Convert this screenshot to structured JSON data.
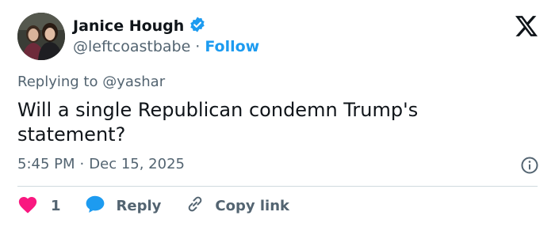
{
  "author": {
    "name": "Janice Hough",
    "handle": "@leftcoastbabe",
    "separator": "·",
    "follow_label": "Follow",
    "verified_icon": "verified-badge-icon",
    "avatar_alt": "avatar"
  },
  "platform_icon": "x-logo-icon",
  "tweet": {
    "replying_to": "Replying to @yashar",
    "text": "Will a single Republican condemn Trump's statement?",
    "time": "5:45 PM",
    "separator": "·",
    "date": "Dec 15, 2025"
  },
  "actions": {
    "like_count": "1",
    "reply_label": "Reply",
    "copy_link_label": "Copy link"
  },
  "colors": {
    "accent": "#1d9bf0",
    "like": "#f91880",
    "muted": "#536471",
    "text": "#0f1419",
    "divider": "#cfd9de"
  }
}
